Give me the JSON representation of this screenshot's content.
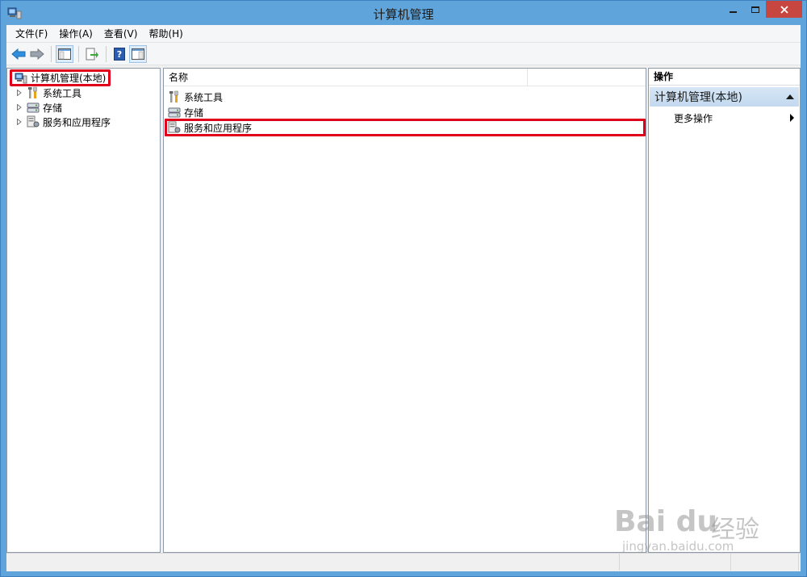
{
  "window": {
    "title": "计算机管理"
  },
  "menu": [
    "文件(F)",
    "操作(A)",
    "查看(V)",
    "帮助(H)"
  ],
  "toolbar": {
    "buttons": [
      "back-icon",
      "forward-icon",
      "show-hide-console-tree-icon",
      "export-list-icon",
      "help-icon",
      "show-hide-action-pane-icon"
    ]
  },
  "tree": {
    "root": "计算机管理(本地)",
    "children": [
      {
        "label": "系统工具",
        "icon": "system-tools-icon"
      },
      {
        "label": "存储",
        "icon": "storage-icon"
      },
      {
        "label": "服务和应用程序",
        "icon": "services-apps-icon"
      }
    ]
  },
  "list": {
    "column_header": "名称",
    "rows": [
      {
        "label": "系统工具",
        "icon": "system-tools-icon"
      },
      {
        "label": "存储",
        "icon": "storage-icon"
      },
      {
        "label": "服务和应用程序",
        "icon": "services-apps-icon"
      }
    ]
  },
  "actions": {
    "header": "操作",
    "group_title": "计算机管理(本地)",
    "more_actions": "更多操作"
  },
  "watermark": {
    "logo": "Bai du",
    "text": "经验",
    "url": "jingyan.baidu.com"
  },
  "colors": {
    "highlight": "#e0001a",
    "titlebar": "#5fa5dc",
    "close_button": "#c7463f"
  }
}
